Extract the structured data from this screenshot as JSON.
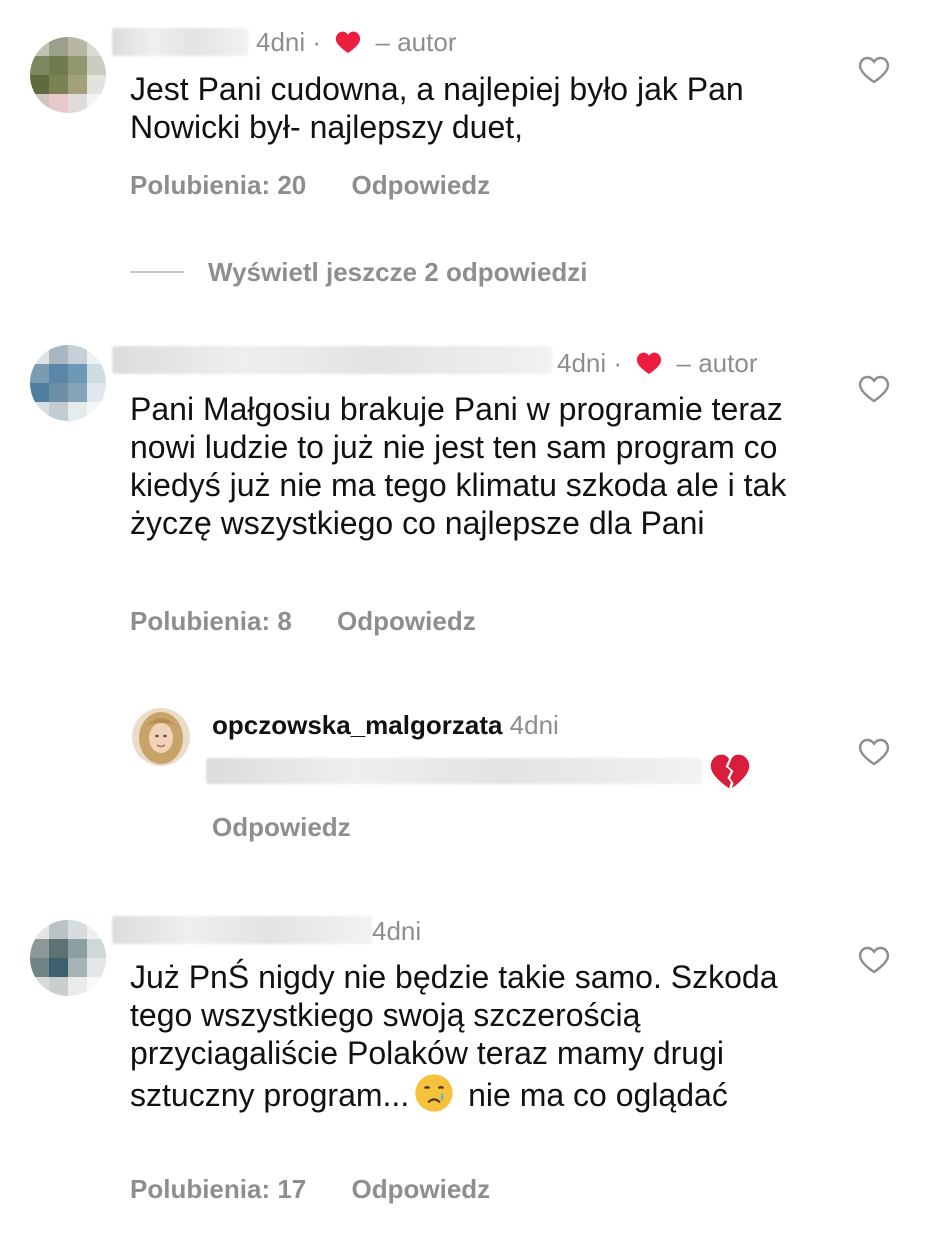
{
  "comments": [
    {
      "time": "4dni",
      "separator": "·",
      "author_tag": "– autor",
      "text": "Jest Pani cudowna, a najlepiej było jak Pan Nowicki był- najlepszy duet,",
      "likes": "Polubienia: 20",
      "reply": "Odpowiedz",
      "view_replies": "Wyświetl jeszcze 2 odpowiedzi"
    },
    {
      "time": "4dni",
      "separator": "·",
      "author_tag": "– autor",
      "text": "Pani Małgosiu brakuje Pani w programie teraz nowi ludzie to już nie jest ten sam program co kiedyś już nie ma tego klimatu szkoda ale i tak życzę wszystkiego co najlepsze dla Pani",
      "likes": "Polubienia: 8",
      "reply": "Odpowiedz"
    },
    {
      "time": "4dni",
      "text_part1": "Już PnŚ nigdy nie będzie takie samo. Szkoda tego wszystkiego swoją szczerością przyciagaliście Polaków teraz mamy drugi sztuczny program...",
      "text_part2": " nie ma co oglądać",
      "emoji": "crying-face",
      "likes": "Polubienia: 17",
      "reply": "Odpowiedz"
    }
  ],
  "author_reply": {
    "username": "opczowska_malgorzata",
    "time": "4dni",
    "emoji": "broken-heart",
    "reply": "Odpowiedz"
  },
  "colors": {
    "text": "#111111",
    "muted": "#8e8e8e",
    "heart": "#ed1d3f",
    "divider": "#c7c7c7"
  }
}
